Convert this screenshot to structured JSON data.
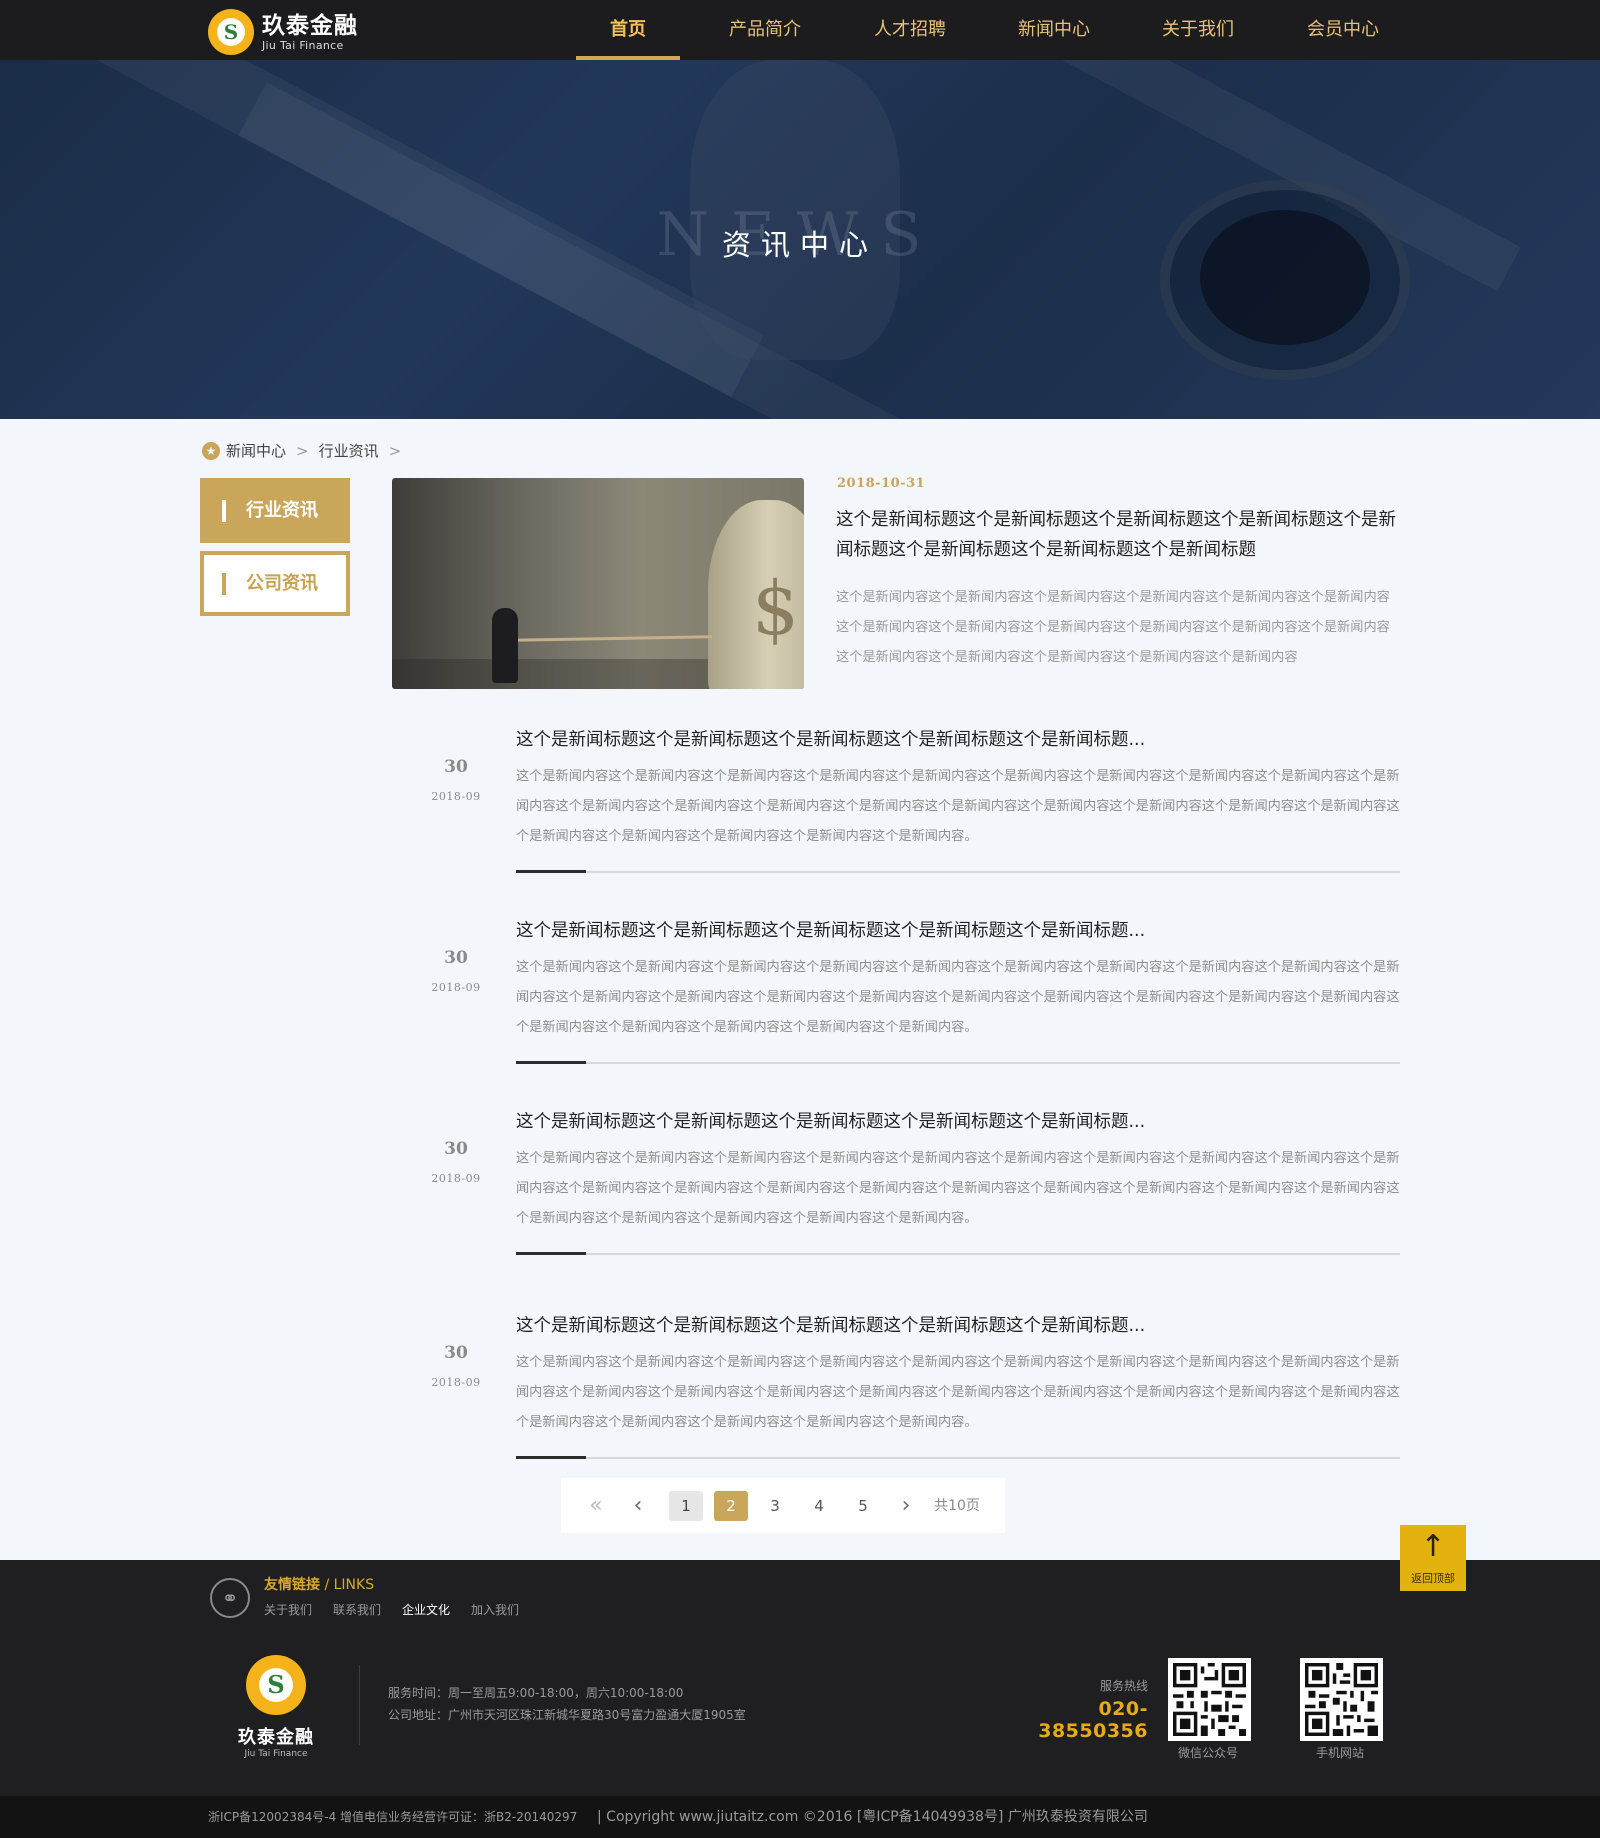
{
  "header": {
    "logo_cn": "玖泰金融",
    "logo_en": "Jiu Tai Finance",
    "nav": [
      {
        "label": "首页",
        "active": true
      },
      {
        "label": "产品简介",
        "active": false
      },
      {
        "label": "人才招聘",
        "active": false
      },
      {
        "label": "新闻中心",
        "active": false
      },
      {
        "label": "关于我们",
        "active": false
      },
      {
        "label": "会员中心",
        "active": false
      }
    ]
  },
  "banner": {
    "bg_word": "NEWS",
    "title": "资讯中心"
  },
  "breadcrumb": {
    "items": [
      "新闻中心",
      "行业资讯"
    ],
    "separator": ">"
  },
  "sidebar": {
    "items": [
      {
        "label": "行业资讯",
        "active": true
      },
      {
        "label": "公司资讯",
        "active": false
      }
    ]
  },
  "featured": {
    "date": "2018-10-31",
    "title": "这个是新闻标题这个是新闻标题这个是新闻标题这个是新闻标题这个是新闻标题这个是新闻标题这个是新闻标题这个是新闻标题",
    "body": "这个是新闻内容这个是新闻内容这个是新闻内容这个是新闻内容这个是新闻内容这个是新闻内容这个是新闻内容这个是新闻内容这个是新闻内容这个是新闻内容这个是新闻内容这个是新闻内容这个是新闻内容这个是新闻内容这个是新闻内容这个是新闻内容这个是新闻内容"
  },
  "news": [
    {
      "day": "30",
      "year_month": "2018-09",
      "title": "这个是新闻标题这个是新闻标题这个是新闻标题这个是新闻标题这个是新闻标题...",
      "body": "这个是新闻内容这个是新闻内容这个是新闻内容这个是新闻内容这个是新闻内容这个是新闻内容这个是新闻内容这个是新闻内容这个是新闻内容这个是新闻内容这个是新闻内容这个是新闻内容这个是新闻内容这个是新闻内容这个是新闻内容这个是新闻内容这个是新闻内容这个是新闻内容这个是新闻内容这个是新闻内容这个是新闻内容这个是新闻内容这个是新闻内容这个是新闻内容。"
    },
    {
      "day": "30",
      "year_month": "2018-09",
      "title": "这个是新闻标题这个是新闻标题这个是新闻标题这个是新闻标题这个是新闻标题...",
      "body": "这个是新闻内容这个是新闻内容这个是新闻内容这个是新闻内容这个是新闻内容这个是新闻内容这个是新闻内容这个是新闻内容这个是新闻内容这个是新闻内容这个是新闻内容这个是新闻内容这个是新闻内容这个是新闻内容这个是新闻内容这个是新闻内容这个是新闻内容这个是新闻内容这个是新闻内容这个是新闻内容这个是新闻内容这个是新闻内容这个是新闻内容这个是新闻内容。"
    },
    {
      "day": "30",
      "year_month": "2018-09",
      "title": "这个是新闻标题这个是新闻标题这个是新闻标题这个是新闻标题这个是新闻标题...",
      "body": "这个是新闻内容这个是新闻内容这个是新闻内容这个是新闻内容这个是新闻内容这个是新闻内容这个是新闻内容这个是新闻内容这个是新闻内容这个是新闻内容这个是新闻内容这个是新闻内容这个是新闻内容这个是新闻内容这个是新闻内容这个是新闻内容这个是新闻内容这个是新闻内容这个是新闻内容这个是新闻内容这个是新闻内容这个是新闻内容这个是新闻内容这个是新闻内容。"
    },
    {
      "day": "30",
      "year_month": "2018-09",
      "title": "这个是新闻标题这个是新闻标题这个是新闻标题这个是新闻标题这个是新闻标题...",
      "body": "这个是新闻内容这个是新闻内容这个是新闻内容这个是新闻内容这个是新闻内容这个是新闻内容这个是新闻内容这个是新闻内容这个是新闻内容这个是新闻内容这个是新闻内容这个是新闻内容这个是新闻内容这个是新闻内容这个是新闻内容这个是新闻内容这个是新闻内容这个是新闻内容这个是新闻内容这个是新闻内容这个是新闻内容这个是新闻内容这个是新闻内容这个是新闻内容。"
    }
  ],
  "pagination": {
    "first": "«",
    "prev": "‹",
    "pages": [
      "1",
      "2",
      "3",
      "4",
      "5"
    ],
    "current": "2",
    "next": "›",
    "total": "共10页"
  },
  "back_to_top": {
    "arrow": "↑",
    "label": "返回顶部"
  },
  "footer": {
    "links_title": "友情链接",
    "links_title_en": " / LINKS",
    "links": [
      {
        "label": "关于我们",
        "highlight": false
      },
      {
        "label": "联系我们",
        "highlight": false
      },
      {
        "label": "企业文化",
        "highlight": true
      },
      {
        "label": "加入我们",
        "highlight": false
      }
    ],
    "logo_cn": "玖泰金融",
    "logo_en": "Jiu Tai Finance",
    "service_hours": "服务时间：周一至周五9:00-18:00，周六10:00-18:00",
    "address": "公司地址：广州市天河区珠江新城华夏路30号富力盈通大厦1905室",
    "hotline_label": "服务热线",
    "hotline": "020-38550356",
    "qr_wechat_caption": "微信公众号",
    "qr_mobile_caption": "手机网站",
    "icp_left": "浙ICP备12002384号-4  增值电信业务经营许可证：浙B2-20140297",
    "copyright": "|   Copyright www.jiutaitz.com ©2016 [粤ICP备14049938号] 广州玖泰投资有限公司"
  },
  "colors": {
    "gold": "#caa65a",
    "nav_gold": "#e6c375",
    "hotline": "#e8ab18",
    "header_bg": "#1c1b1d",
    "footer_bg": "#1f1f22"
  }
}
